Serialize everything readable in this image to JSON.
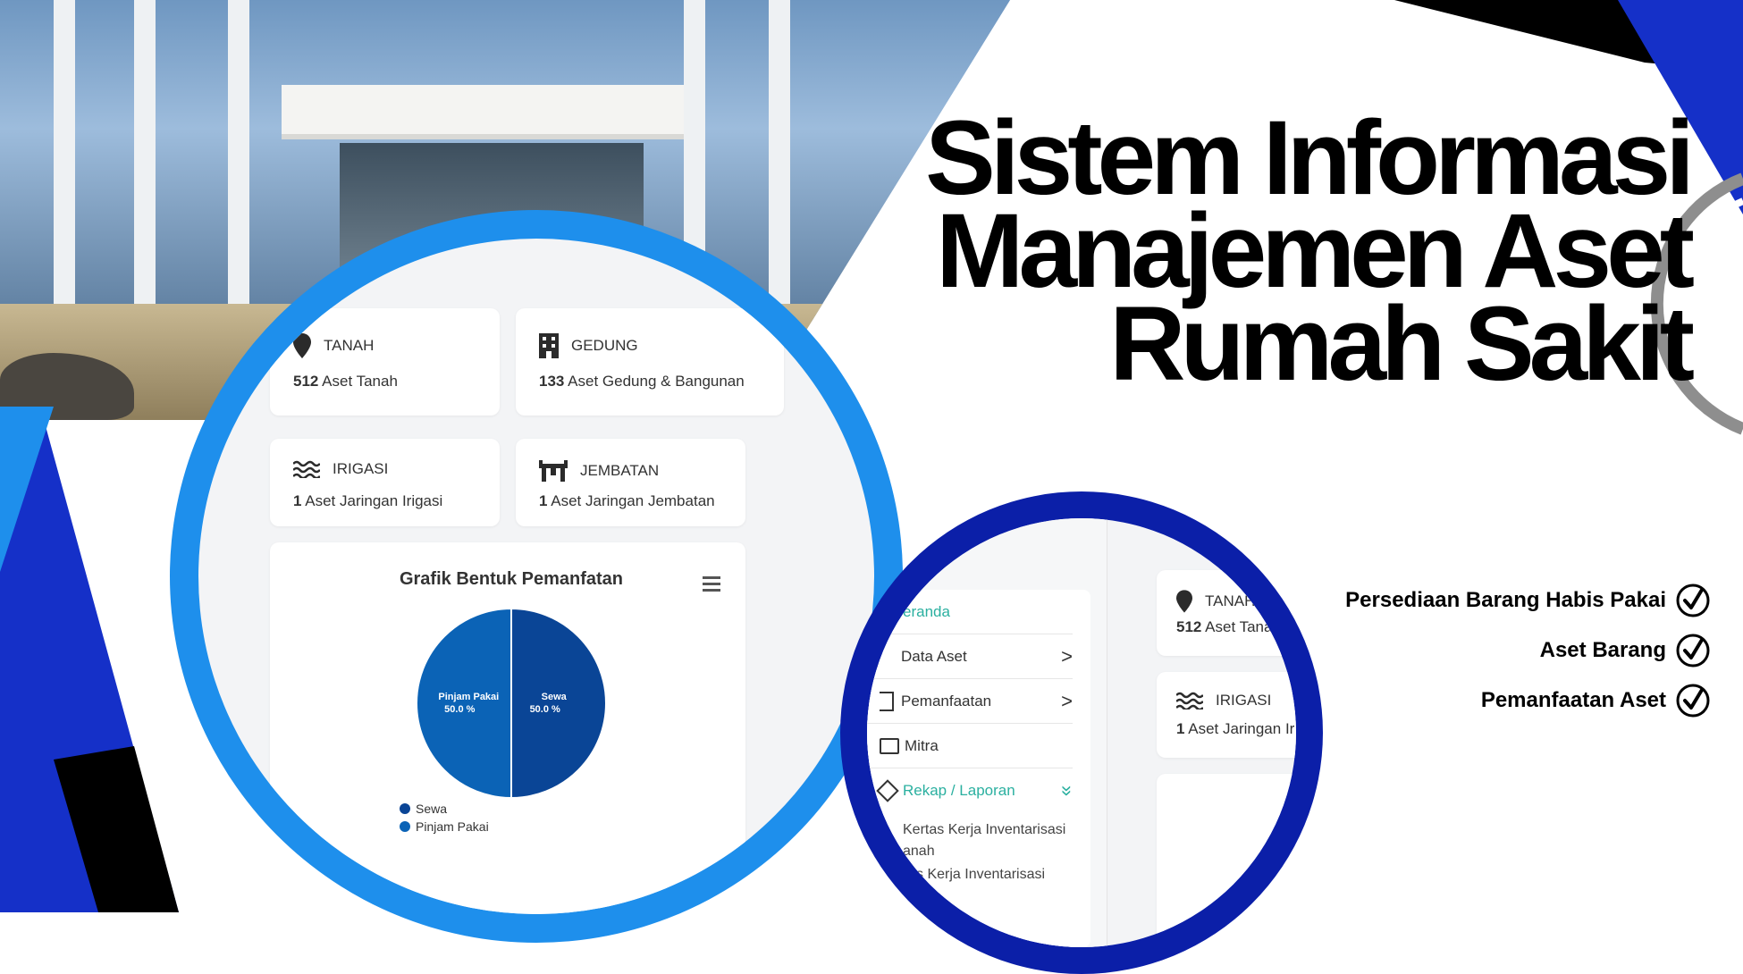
{
  "title": {
    "line1": "Sistem Informasi",
    "line2": "Manajemen Aset",
    "line3": "Rumah Sakit"
  },
  "features": [
    {
      "label": "Persediaan Barang Habis Pakai"
    },
    {
      "label": "Aset Barang"
    },
    {
      "label": "Pemanfaatan Aset"
    }
  ],
  "dashboard": {
    "cards": [
      {
        "label": "TANAH",
        "count": "512",
        "desc": "Aset Tanah",
        "icon": "map-pin-icon"
      },
      {
        "label": "GEDUNG",
        "count": "133",
        "desc": "Aset Gedung & Bangunan",
        "icon": "building-icon"
      },
      {
        "label": "IRIGASI",
        "count": "1",
        "desc": "Aset Jaringan Irigasi",
        "icon": "water-waves-icon"
      },
      {
        "label": "JEMBATAN",
        "count": "1",
        "desc": "Aset Jaringan Jembatan",
        "icon": "bridge-icon"
      }
    ],
    "chart_title": "Grafik Bentuk Pemanfatan",
    "menu_icon": "hamburger-menu-icon"
  },
  "chart_data": {
    "type": "pie",
    "title": "Grafik Bentuk Pemanfatan",
    "slices": [
      {
        "name": "Pinjam Pakai",
        "value": 50.0,
        "label": "50.0 %",
        "color": "#0b63b6"
      },
      {
        "name": "Sewa",
        "value": 50.0,
        "label": "50.0 %",
        "color": "#0a4596"
      }
    ],
    "legend": [
      "Sewa",
      "Pinjam Pakai"
    ],
    "legend_position": "bottom-left"
  },
  "sidebar": {
    "items": [
      {
        "label": "eranda",
        "active": true,
        "icon": ""
      },
      {
        "label": "Data Aset",
        "icon": "folder-icon",
        "chevron": ">"
      },
      {
        "label": "Pemanfaatan",
        "icon": "document-icon",
        "chevron": ">"
      },
      {
        "label": "Mitra",
        "icon": "id-card-icon"
      },
      {
        "label": "Rekap / Laporan",
        "icon": "tag-icon",
        "chevron": "»",
        "active": true
      },
      {
        "label": "Kertas Kerja Inventarisasi",
        "sub": "anah"
      },
      {
        "label": "s Kerja Inventarisasi"
      }
    ],
    "cards": [
      {
        "label": "TANAH",
        "count": "512",
        "desc": "Aset Tana"
      },
      {
        "label": "IRIGASI",
        "count": "1",
        "desc": "Aset Jaringan Ir"
      }
    ]
  },
  "colors": {
    "accent_blue": "#1e8fec",
    "dark_blue": "#0b1fa8",
    "royal_blue": "#1530c8",
    "black": "#000000"
  }
}
